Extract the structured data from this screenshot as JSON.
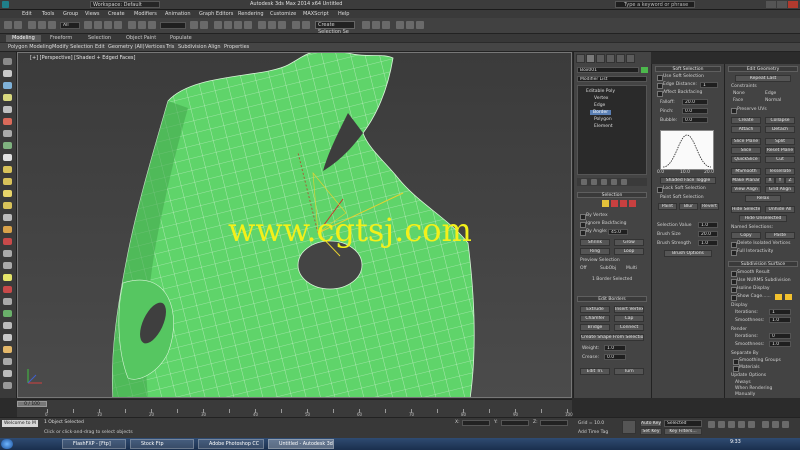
{
  "titlebar": {
    "workspace": "Workspace: Default",
    "title": "Autodesk 3ds Max 2014 x64    Untitled",
    "search_placeholder": "Type a keyword or phrase"
  },
  "menu": [
    "Edit",
    "Tools",
    "Group",
    "Views",
    "Create",
    "Modifiers",
    "Animation",
    "Graph Editors",
    "Rendering",
    "Customize",
    "MAXScript",
    "Help"
  ],
  "toolbar": {
    "filter": "All",
    "selection_set": "Create Selection Se"
  },
  "ribbon": {
    "tabs": [
      "Modeling",
      "Freeform",
      "Selection",
      "Object Paint",
      "Populate"
    ],
    "subtabs": [
      "Polygon Modeling",
      "Modify Selection",
      "Edit",
      "Geometry (All)",
      "Vertices",
      "Tris",
      "Subdivision",
      "Align",
      "Properties"
    ]
  },
  "viewport": {
    "label": "[+] [Perspective] [Shaded + Edged Faces]",
    "watermark": "www.cgtsj.com"
  },
  "command_panel": {
    "object_name": "Box001",
    "modifier_list": "Modifier List",
    "stack_items": [
      "Editable Poly",
      "Vertex",
      "Edge",
      "Border",
      "Polygon",
      "Element"
    ],
    "selected_stack_item": "Border",
    "selection_header": "Selection",
    "options": [
      "By Vertex",
      "Ignore Backfacing",
      "By Angle:",
      "Shrink",
      "Grow",
      "Ring",
      "Loop"
    ],
    "angle_value": "45.0",
    "preview_selection_label": "Preview Selection",
    "preview_options": [
      "Off",
      "SubObj",
      "Multi"
    ],
    "selected_status": "1 Border Selected",
    "edit_borders_header": "Edit Borders",
    "edit_border_buttons": [
      "Extrude",
      "Insert Vertex",
      "Chamfer",
      "Cap",
      "Bridge",
      "Connect"
    ],
    "create_shape_label": "Create Shape From Selection",
    "weight_label": "Weight:",
    "weight_value": "1.0",
    "crease_label": "Crease:",
    "crease_value": "0.0",
    "edit_tri_label": "Edit Tri.",
    "turn_label": "Turn"
  },
  "soft_selection": {
    "header": "Soft Selection",
    "use_soft": "Use Soft Selection",
    "edge_distance": "Edge Distance:",
    "edge_distance_value": "1",
    "affect_backfacing": "Affect Backfacing",
    "falloff_label": "Falloff:",
    "falloff_value": "20.0",
    "pinch_label": "Pinch:",
    "pinch_value": "0.0",
    "bubble_label": "Bubble:",
    "bubble_value": "0.0",
    "curve_labels": [
      "0.0",
      "10.0",
      "20.0"
    ],
    "shaded_face_toggle": "Shaded Face Toggle",
    "lock_soft": "Lock Soft Selection",
    "paint_soft_header": "Paint Soft Selection",
    "paint_buttons": [
      "Paint",
      "Blur",
      "Revert"
    ],
    "selection_value": "Selection Value",
    "selection_value_num": "1.0",
    "brush_size": "Brush Size",
    "brush_size_num": "20.0",
    "brush_strength": "Brush Strength",
    "brush_strength_num": "1.0",
    "brush_options": "Brush Options"
  },
  "edit_geometry": {
    "header": "Edit Geometry",
    "repeat_last": "Repeat Last",
    "constraints_label": "Constraints",
    "constraint_options": [
      "None",
      "Edge",
      "Face",
      "Normal"
    ],
    "preserve_uvs": "Preserve UVs",
    "create": "Create",
    "collapse": "Collapse",
    "attach": "Attach",
    "detach": "Detach",
    "slice_plane": "Slice Plane",
    "split": "Split",
    "slice": "Slice",
    "reset_plane": "Reset Plane",
    "quickslice": "QuickSlice",
    "cut": "Cut",
    "msmooth": "MSmooth",
    "tessellate": "Tessellate",
    "make_planar": "Make Planar",
    "xyz": [
      "X",
      "Y",
      "Z"
    ],
    "view_align": "View Align",
    "grid_align": "Grid Align",
    "relax": "Relax",
    "hide_buttons": [
      "Hide Selected",
      "Unhide All",
      "Hide Unselected"
    ],
    "named_selections": "Named Selections:",
    "copy_paste": [
      "Copy",
      "Paste"
    ],
    "delete_isolated": "Delete Isolated Vertices",
    "full_interactivity": "Full Interactivity"
  },
  "subdivision_surface": {
    "header": "Subdivision Surface",
    "smooth_result": "Smooth Result",
    "use_nurms": "Use NURMS Subdivision",
    "isoline_display": "Isoline Display",
    "show_cage": "Show Cage......",
    "display_label": "Display",
    "iterations_label": "Iterations:",
    "iterations_value": "1",
    "smoothness_label": "Smoothness:",
    "smoothness_value": "1.0",
    "render_label": "Render",
    "render_iterations_value": "0",
    "render_smoothness_value": "1.0",
    "separate_by": "Separate By",
    "smoothing_groups": "Smoothing Groups",
    "materials": "Materials",
    "update_options": "Update Options",
    "always": "Always",
    "when_rendering": "When Rendering",
    "manually": "Manually",
    "update_btn": "Update",
    "cage_colors": [
      "#f2c12e",
      "#f2c12e"
    ]
  },
  "timeline": {
    "slider": "0 / 100",
    "ticks": [
      "0",
      "5",
      "10",
      "15",
      "20",
      "25",
      "30",
      "35",
      "40",
      "45",
      "50",
      "55",
      "60",
      "65",
      "70",
      "75",
      "80",
      "85",
      "90",
      "95",
      "100"
    ]
  },
  "status": {
    "line1": "1 Object Selected",
    "line2": "Click or click-and-drag to select objects",
    "welcome": "Welcome to M",
    "x_label": "X:",
    "y_label": "Y:",
    "z_label": "Z:",
    "grid": "Grid = 10.0",
    "auto_key": "Auto Key",
    "set_key": "Set Key",
    "selected": "Selected",
    "key_filters": "Key Filters...",
    "add_time_tag": "Add Time Tag"
  },
  "taskbar": {
    "tasks": [
      "FlashFXP - [Ftp]",
      "Stock Ftp",
      "Adobe Photoshop CC",
      "Untitled - Autodesk 3ds Max"
    ],
    "time": "9:33"
  },
  "colors": {
    "mesh": "#5fd46a",
    "accent_highlight": "#5a7fb4",
    "watermark": "#f3f01a"
  }
}
